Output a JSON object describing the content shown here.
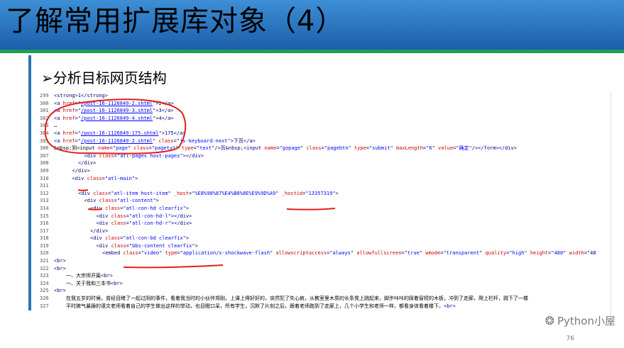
{
  "slide": {
    "title": "了解常用扩展库对象（4）",
    "subtitle": "➢分析目标网页结构",
    "page_number": "76",
    "watermark": "Python小屋"
  },
  "code_lines": [
    {
      "no": "299",
      "indent": 0,
      "parts": [
        {
          "c": "tag",
          "t": "<strong>1</strong>"
        }
      ]
    },
    {
      "no": "300",
      "indent": 0,
      "parts": [
        {
          "c": "tag",
          "t": "<a "
        },
        {
          "c": "attr",
          "t": "href"
        },
        {
          "c": "tag",
          "t": "=\""
        },
        {
          "c": "lnk",
          "t": "/post-16-1126849-2.shtml"
        },
        {
          "c": "tag",
          "t": "\">2</a>"
        }
      ]
    },
    {
      "no": "301",
      "indent": 0,
      "parts": [
        {
          "c": "tag",
          "t": "<a "
        },
        {
          "c": "attr",
          "t": "href"
        },
        {
          "c": "tag",
          "t": "=\""
        },
        {
          "c": "lnk",
          "t": "/post-16-1126849-3.shtml"
        },
        {
          "c": "tag",
          "t": "\">3</a>"
        }
      ]
    },
    {
      "no": "302",
      "indent": 0,
      "parts": [
        {
          "c": "tag",
          "t": "<a "
        },
        {
          "c": "attr",
          "t": "href"
        },
        {
          "c": "tag",
          "t": "=\""
        },
        {
          "c": "lnk",
          "t": "/post-16-1126849-4.shtml"
        },
        {
          "c": "tag",
          "t": "\">4</a>"
        }
      ]
    },
    {
      "no": "303",
      "indent": 0,
      "parts": [
        {
          "c": "txt",
          "t": "…"
        }
      ]
    },
    {
      "no": "304",
      "indent": 0,
      "parts": [
        {
          "c": "tag",
          "t": "<a "
        },
        {
          "c": "attr",
          "t": "href"
        },
        {
          "c": "tag",
          "t": "=\""
        },
        {
          "c": "lnk",
          "t": "/post-16-1126849-175.shtml"
        },
        {
          "c": "tag",
          "t": "\">175</a>"
        }
      ]
    },
    {
      "no": "305",
      "indent": 0,
      "parts": [
        {
          "c": "tag",
          "t": "<a "
        },
        {
          "c": "attr",
          "t": "href"
        },
        {
          "c": "tag",
          "t": "=\""
        },
        {
          "c": "lnk",
          "t": "/post-16-1126849-2.shtml"
        },
        {
          "c": "tag",
          "t": "\" "
        },
        {
          "c": "attr",
          "t": "class"
        },
        {
          "c": "tag",
          "t": "=\""
        },
        {
          "c": "val",
          "t": "js-keyboard-next"
        },
        {
          "c": "tag",
          "t": "\">下页</a>"
        }
      ]
    },
    {
      "no": "306",
      "indent": 0,
      "parts": [
        {
          "c": "txt",
          "t": "&nbsp;到<input "
        },
        {
          "c": "attr",
          "t": "name"
        },
        {
          "c": "tag",
          "t": "=\""
        },
        {
          "c": "val",
          "t": "page"
        },
        {
          "c": "tag",
          "t": "\" "
        },
        {
          "c": "attr",
          "t": "class"
        },
        {
          "c": "tag",
          "t": "=\""
        },
        {
          "c": "val",
          "t": "pagetxt"
        },
        {
          "c": "tag",
          "t": "\" "
        },
        {
          "c": "attr",
          "t": "type"
        },
        {
          "c": "tag",
          "t": "=\""
        },
        {
          "c": "val",
          "t": "text"
        },
        {
          "c": "tag",
          "t": "\"/>页&nbsp;<input "
        },
        {
          "c": "attr",
          "t": "name"
        },
        {
          "c": "tag",
          "t": "=\""
        },
        {
          "c": "val",
          "t": "gopage"
        },
        {
          "c": "tag",
          "t": "\" "
        },
        {
          "c": "attr",
          "t": "class"
        },
        {
          "c": "tag",
          "t": "=\""
        },
        {
          "c": "val",
          "t": "pagebtn"
        },
        {
          "c": "tag",
          "t": "\" "
        },
        {
          "c": "attr",
          "t": "type"
        },
        {
          "c": "tag",
          "t": "=\""
        },
        {
          "c": "val",
          "t": "submit"
        },
        {
          "c": "tag",
          "t": "\" "
        },
        {
          "c": "attr",
          "t": "maxLength"
        },
        {
          "c": "tag",
          "t": "=\""
        },
        {
          "c": "val",
          "t": "6"
        },
        {
          "c": "tag",
          "t": "\" "
        },
        {
          "c": "attr",
          "t": "value"
        },
        {
          "c": "tag",
          "t": "=\""
        },
        {
          "c": "val",
          "t": "确定"
        },
        {
          "c": "tag",
          "t": "\"/></form></div>"
        }
      ]
    },
    {
      "no": "307",
      "indent": 5,
      "parts": [
        {
          "c": "tag",
          "t": "<div "
        },
        {
          "c": "attr",
          "t": "class"
        },
        {
          "c": "tag",
          "t": "=\""
        },
        {
          "c": "val",
          "t": "atl-pages host-pages"
        },
        {
          "c": "tag",
          "t": "\"></div>"
        }
      ]
    },
    {
      "no": "308",
      "indent": 4,
      "parts": [
        {
          "c": "tag",
          "t": "</div>"
        }
      ]
    },
    {
      "no": "309",
      "indent": 3,
      "parts": [
        {
          "c": "tag",
          "t": "</div>"
        }
      ]
    },
    {
      "no": "310",
      "indent": 3,
      "parts": [
        {
          "c": "tag",
          "t": "<div "
        },
        {
          "c": "attr",
          "t": "class"
        },
        {
          "c": "tag",
          "t": "=\""
        },
        {
          "c": "val",
          "t": "atl-main"
        },
        {
          "c": "tag",
          "t": "\">"
        }
      ]
    },
    {
      "no": "311",
      "indent": 0,
      "parts": []
    },
    {
      "no": "312",
      "indent": 4,
      "parts": [
        {
          "c": "tag",
          "t": "<div "
        },
        {
          "c": "attr",
          "t": "class"
        },
        {
          "c": "tag",
          "t": "=\""
        },
        {
          "c": "val",
          "t": "atl-item host-item"
        },
        {
          "c": "tag",
          "t": "\" "
        },
        {
          "c": "attr",
          "t": "_host"
        },
        {
          "c": "tag",
          "t": "=\""
        },
        {
          "c": "val",
          "t": "%E8%98%87%E4%B8%8E%E9%9D%A9"
        },
        {
          "c": "tag",
          "t": "\" "
        },
        {
          "c": "attr",
          "t": "_hostid"
        },
        {
          "c": "tag",
          "t": "=\""
        },
        {
          "c": "val",
          "t": "13357319"
        },
        {
          "c": "tag",
          "t": "\">"
        }
      ]
    },
    {
      "no": "313",
      "indent": 5,
      "parts": [
        {
          "c": "tag",
          "t": "<div "
        },
        {
          "c": "attr",
          "t": "class"
        },
        {
          "c": "tag",
          "t": "=\""
        },
        {
          "c": "val",
          "t": "atl-content"
        },
        {
          "c": "tag",
          "t": "\">"
        }
      ]
    },
    {
      "no": "314",
      "indent": 6,
      "parts": [
        {
          "c": "tag",
          "t": "<div "
        },
        {
          "c": "attr",
          "t": "class"
        },
        {
          "c": "tag",
          "t": "=\""
        },
        {
          "c": "val",
          "t": "atl-con-hd clearfix"
        },
        {
          "c": "tag",
          "t": "\">"
        }
      ]
    },
    {
      "no": "315",
      "indent": 7,
      "parts": [
        {
          "c": "tag",
          "t": "<div "
        },
        {
          "c": "attr",
          "t": "class"
        },
        {
          "c": "tag",
          "t": "=\""
        },
        {
          "c": "val",
          "t": "atl-con-hd-l"
        },
        {
          "c": "tag",
          "t": "\"></div>"
        }
      ]
    },
    {
      "no": "316",
      "indent": 7,
      "parts": [
        {
          "c": "tag",
          "t": "<div "
        },
        {
          "c": "attr",
          "t": "class"
        },
        {
          "c": "tag",
          "t": "=\""
        },
        {
          "c": "val",
          "t": "atl-con-hd-r"
        },
        {
          "c": "tag",
          "t": "\"></div>"
        }
      ]
    },
    {
      "no": "317",
      "indent": 6,
      "parts": [
        {
          "c": "tag",
          "t": "</div>"
        }
      ]
    },
    {
      "no": "318",
      "indent": 6,
      "parts": [
        {
          "c": "tag",
          "t": "<div "
        },
        {
          "c": "attr",
          "t": "class"
        },
        {
          "c": "tag",
          "t": "=\""
        },
        {
          "c": "val",
          "t": "atl-con-bd clearfix"
        },
        {
          "c": "tag",
          "t": "\">"
        }
      ]
    },
    {
      "no": "319",
      "indent": 7,
      "parts": [
        {
          "c": "tag",
          "t": "<div "
        },
        {
          "c": "attr",
          "t": "class"
        },
        {
          "c": "tag",
          "t": "=\""
        },
        {
          "c": "val",
          "t": "bbs-content clearfix"
        },
        {
          "c": "tag",
          "t": "\">"
        }
      ]
    },
    {
      "no": "320",
      "indent": 8,
      "parts": [
        {
          "c": "tag",
          "t": "<embed "
        },
        {
          "c": "attr",
          "t": "class"
        },
        {
          "c": "tag",
          "t": "=\""
        },
        {
          "c": "val",
          "t": "video"
        },
        {
          "c": "tag",
          "t": "\" "
        },
        {
          "c": "attr",
          "t": "type"
        },
        {
          "c": "tag",
          "t": "=\""
        },
        {
          "c": "val",
          "t": "application/x-shockwave-flash"
        },
        {
          "c": "tag",
          "t": "\" "
        },
        {
          "c": "attr",
          "t": "allowscriptaccess"
        },
        {
          "c": "tag",
          "t": "=\""
        },
        {
          "c": "val",
          "t": "always"
        },
        {
          "c": "tag",
          "t": "\" "
        },
        {
          "c": "attr",
          "t": "allowfullscreen"
        },
        {
          "c": "tag",
          "t": "=\""
        },
        {
          "c": "val",
          "t": "true"
        },
        {
          "c": "tag",
          "t": "\" "
        },
        {
          "c": "attr",
          "t": "wmode"
        },
        {
          "c": "tag",
          "t": "=\""
        },
        {
          "c": "val",
          "t": "transparent"
        },
        {
          "c": "tag",
          "t": "\" "
        },
        {
          "c": "attr",
          "t": "quality"
        },
        {
          "c": "tag",
          "t": "=\""
        },
        {
          "c": "val",
          "t": "high"
        },
        {
          "c": "tag",
          "t": "\" "
        },
        {
          "c": "attr",
          "t": "height"
        },
        {
          "c": "tag",
          "t": "=\""
        },
        {
          "c": "val",
          "t": "480"
        },
        {
          "c": "tag",
          "t": "\" "
        },
        {
          "c": "attr",
          "t": "width"
        },
        {
          "c": "tag",
          "t": "=\"48"
        }
      ]
    },
    {
      "no": "321",
      "indent": 0,
      "parts": [
        {
          "c": "tag",
          "t": "<br>"
        }
      ]
    },
    {
      "no": "322",
      "indent": 0,
      "parts": [
        {
          "c": "tag",
          "t": "<br>"
        }
      ]
    },
    {
      "no": "323",
      "indent": 2,
      "parts": [
        {
          "c": "txt",
          "t": "一、大宗师开篇"
        },
        {
          "c": "tag",
          "t": "<br>"
        }
      ]
    },
    {
      "no": "324",
      "indent": 2,
      "parts": [
        {
          "c": "txt",
          "t": "一、关于我和三本书"
        },
        {
          "c": "tag",
          "t": "<br>"
        }
      ]
    },
    {
      "no": "325",
      "indent": 0,
      "parts": [
        {
          "c": "tag",
          "t": "<br>"
        }
      ]
    },
    {
      "no": "326",
      "indent": 2,
      "parts": [
        {
          "c": "txt",
          "t": "在我五岁的时候，曾经目睹了一起过阴的事件，看着我当时的小伙伴郑刚，上课上得好好的，突然犯了失心疯，从教室里木质的长条凳上跳起来，脚步咔咔的踩着窗棂的木板，冲到了走廊，爬上栏杆，跳下了一楼"
        }
      ]
    },
    {
      "no": "327",
      "indent": 2,
      "parts": [
        {
          "c": "txt",
          "t": "平时脾气暴躁的语文老师看着自己的学生做出这样的举动，也目瞪口呆，所有学生，沉默了片刻之后，跟着老师跑到了走廊上，几个小学生和老师一样，都看身体看着楼下。"
        },
        {
          "c": "tag",
          "t": "<br>"
        }
      ]
    }
  ]
}
